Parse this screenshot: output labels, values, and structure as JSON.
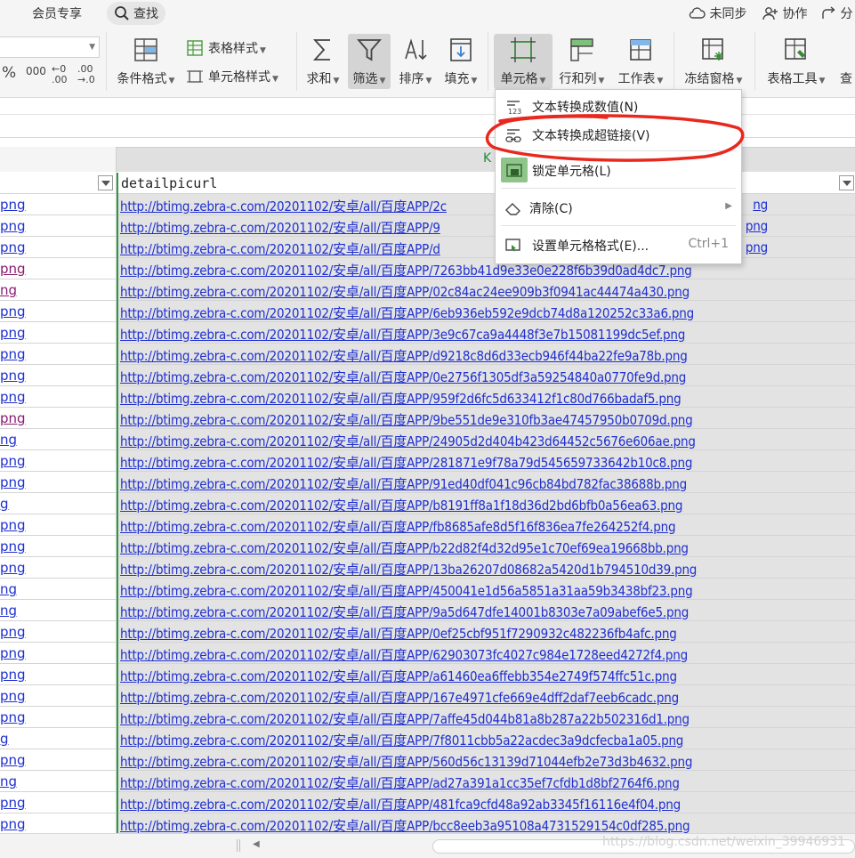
{
  "menubar": {
    "member": "会员专享",
    "search": "查找",
    "sync": "未同步",
    "collab": "协作",
    "share": "分"
  },
  "ribbon": {
    "numfmt": [
      "%",
      "000",
      "←0\n.00",
      ".00\n→.0"
    ],
    "table_style": "表格样式",
    "cond_format": "条件格式",
    "cell_style": "单元格样式",
    "sum": "求和",
    "filter": "筛选",
    "sort": "排序",
    "fill": "填充",
    "cell": "单元格",
    "rowcol": "行和列",
    "worksheet": "工作表",
    "freeze": "冻结窗格",
    "table_tools": "表格工具",
    "more": "查"
  },
  "sheet": {
    "column_letter": "K",
    "header": "detailpicurl",
    "url_prefix": "http://btimg.zebra-c.com/20201102/安卓/all/百度APP/",
    "left_partial": [
      "png",
      "png",
      "png",
      "png",
      "ng",
      "png",
      "png",
      "png",
      "png",
      "png",
      "png",
      "ng",
      "png",
      "png",
      "g",
      "png",
      "png",
      "png",
      "ng",
      "ng",
      "png",
      "png",
      "png",
      "png",
      "png",
      "g",
      "png",
      "ng",
      "png",
      "png"
    ],
    "left_visited": [
      false,
      false,
      false,
      true,
      true,
      false,
      false,
      false,
      false,
      false,
      true,
      false,
      false,
      false,
      false,
      false,
      false,
      false,
      false,
      false,
      false,
      false,
      false,
      false,
      false,
      false,
      false,
      false,
      false,
      false
    ],
    "rows": [
      "http://btimg.zebra-c.com/20201102/安卓/all/百度APP/2c",
      "http://btimg.zebra-c.com/20201102/安卓/all/百度APP/9",
      "http://btimg.zebra-c.com/20201102/安卓/all/百度APP/d",
      "http://btimg.zebra-c.com/20201102/安卓/all/百度APP/7263bb41d9e33e0e228f6b39d0ad4dc7.png",
      "http://btimg.zebra-c.com/20201102/安卓/all/百度APP/02c84ac24ee909b3f0941ac44474a430.png",
      "http://btimg.zebra-c.com/20201102/安卓/all/百度APP/6eb936eb592e9dcb74d8a120252c33a6.png",
      "http://btimg.zebra-c.com/20201102/安卓/all/百度APP/3e9c67ca9a4448f3e7b15081199dc5ef.png",
      "http://btimg.zebra-c.com/20201102/安卓/all/百度APP/d9218c8d6d33ecb946f44ba22fe9a78b.png",
      "http://btimg.zebra-c.com/20201102/安卓/all/百度APP/0e2756f1305df3a59254840a0770fe9d.png",
      "http://btimg.zebra-c.com/20201102/安卓/all/百度APP/959f2d6fc5d633412f1c80d766badaf5.png",
      "http://btimg.zebra-c.com/20201102/安卓/all/百度APP/9be551de9e310fb3ae47457950b0709d.png",
      "http://btimg.zebra-c.com/20201102/安卓/all/百度APP/24905d2d404b423d64452c5676e606ae.png",
      "http://btimg.zebra-c.com/20201102/安卓/all/百度APP/281871e9f78a79d545659733642b10c8.png",
      "http://btimg.zebra-c.com/20201102/安卓/all/百度APP/91ed40df041c96cb84bd782fac38688b.png",
      "http://btimg.zebra-c.com/20201102/安卓/all/百度APP/b8191ff8a1f18d36d2bd6bfb0a56ea63.png",
      "http://btimg.zebra-c.com/20201102/安卓/all/百度APP/fb8685afe8d5f16f836ea7fe264252f4.png",
      "http://btimg.zebra-c.com/20201102/安卓/all/百度APP/b22d82f4d32d95e1c70ef69ea19668bb.png",
      "http://btimg.zebra-c.com/20201102/安卓/all/百度APP/13ba26207d08682a5420d1b794510d39.png",
      "http://btimg.zebra-c.com/20201102/安卓/all/百度APP/450041e1d56a5851a31aa59b3438bf23.png",
      "http://btimg.zebra-c.com/20201102/安卓/all/百度APP/9a5d647dfe14001b8303e7a09abef6e5.png",
      "http://btimg.zebra-c.com/20201102/安卓/all/百度APP/0ef25cbf951f7290932c482236fb4afc.png",
      "http://btimg.zebra-c.com/20201102/安卓/all/百度APP/62903073fc4027c984e1728eed4272f4.png",
      "http://btimg.zebra-c.com/20201102/安卓/all/百度APP/a61460ea6ffebb354e2749f574ffc51c.png",
      "http://btimg.zebra-c.com/20201102/安卓/all/百度APP/167e4971cfe669e4dff2daf7eeb6cadc.png",
      "http://btimg.zebra-c.com/20201102/安卓/all/百度APP/7affe45d044b81a8b287a22b502316d1.png",
      "http://btimg.zebra-c.com/20201102/安卓/all/百度APP/7f8011cbb5a22acdec3a9dcfecba1a05.png",
      "http://btimg.zebra-c.com/20201102/安卓/all/百度APP/560d56c13139d71044efb2e73d3b4632.png",
      "http://btimg.zebra-c.com/20201102/安卓/all/百度APP/ad27a391a1cc35ef7cfdb1d8bf2764f6.png",
      "http://btimg.zebra-c.com/20201102/安卓/all/百度APP/481fca9cfd48a92ab3345f16116e4f04.png",
      "http://btimg.zebra-c.com/20201102/安卓/all/百度APP/bcc8eeb3a95108a4731529154c0df285.png"
    ],
    "row_tails": [
      "ng",
      "png",
      "png"
    ]
  },
  "dropdown": {
    "items": [
      {
        "label": "文本转换成数值(N)",
        "shortcut": ""
      },
      {
        "label": "文本转换成超链接(V)",
        "shortcut": ""
      },
      {
        "label": "锁定单元格(L)",
        "shortcut": ""
      },
      {
        "label": "清除(C)",
        "shortcut": ""
      },
      {
        "label": "设置单元格格式(E)...",
        "shortcut": "Ctrl+1"
      }
    ]
  },
  "watermark": "https://blog.csdn.net/weixin_39946931",
  "colors": {
    "link": "#1e2fd0",
    "visited": "#8a1a6e",
    "selection_border": "#2e9a44",
    "highlight_ring": "#e8281e"
  }
}
